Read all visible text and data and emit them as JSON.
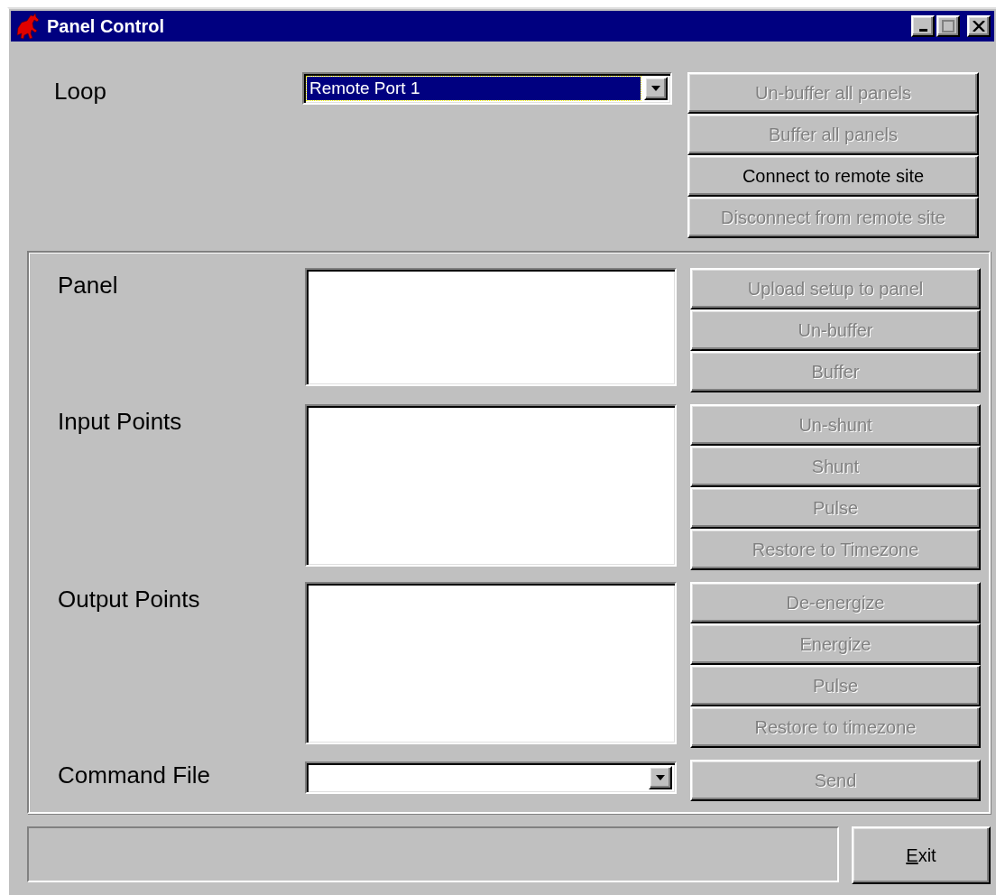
{
  "window": {
    "title": "Panel Control"
  },
  "loop": {
    "label": "Loop",
    "value": "Remote Port 1",
    "focused": true
  },
  "loop_buttons": [
    {
      "label": "Un-buffer all panels",
      "disabled": true
    },
    {
      "label": "Buffer all panels",
      "disabled": true
    },
    {
      "label": "Connect to remote site",
      "disabled": false
    },
    {
      "label": "Disconnect from remote site",
      "disabled": true
    }
  ],
  "sections": [
    {
      "label": "Panel",
      "buttons": [
        {
          "label": "Upload setup to panel",
          "disabled": true
        },
        {
          "label": "Un-buffer",
          "disabled": true
        },
        {
          "label": "Buffer",
          "disabled": true
        }
      ]
    },
    {
      "label": "Input Points",
      "buttons": [
        {
          "label": "Un-shunt",
          "disabled": true
        },
        {
          "label": "Shunt",
          "disabled": true
        },
        {
          "label": "Pulse",
          "disabled": true
        },
        {
          "label": "Restore to Timezone",
          "disabled": true
        }
      ]
    },
    {
      "label": "Output Points",
      "buttons": [
        {
          "label": "De-energize",
          "disabled": true
        },
        {
          "label": "Energize",
          "disabled": true
        },
        {
          "label": "Pulse",
          "disabled": true
        },
        {
          "label": "Restore to timezone",
          "disabled": true
        }
      ]
    }
  ],
  "command_file": {
    "label": "Command File",
    "button": {
      "label": "Send",
      "disabled": true
    }
  },
  "exit_button": {
    "label": "Exit",
    "mnemonic_underlined": true
  }
}
